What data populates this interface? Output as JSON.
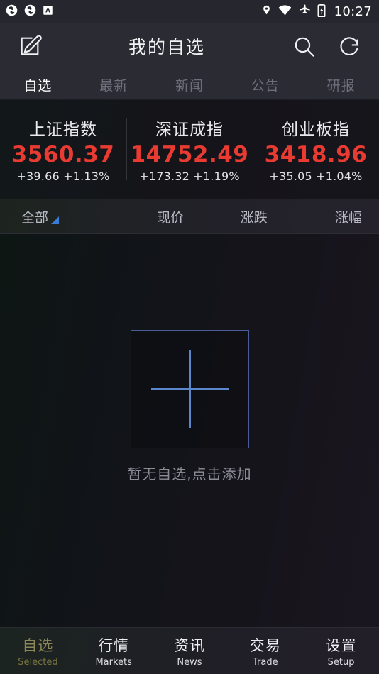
{
  "status_bar": {
    "notification_icons": [
      "sync-circle-icon",
      "sync-circle-icon",
      "letter-a-badge-icon"
    ],
    "system_icons": [
      "location-pin-icon",
      "wifi-icon",
      "airplane-mode-icon",
      "battery-charging-icon"
    ],
    "time": "10:27"
  },
  "header": {
    "edit_icon": "edit-square-icon",
    "title": "我的自选",
    "search_icon": "search-icon",
    "refresh_icon": "refresh-icon"
  },
  "tabs": [
    {
      "label": "自选",
      "active": true
    },
    {
      "label": "最新",
      "active": false
    },
    {
      "label": "新闻",
      "active": false
    },
    {
      "label": "公告",
      "active": false
    },
    {
      "label": "研报",
      "active": false
    }
  ],
  "indices": [
    {
      "name": "上证指数",
      "value": "3560.37",
      "change": "+39.66 +1.13%"
    },
    {
      "name": "深证成指",
      "value": "14752.49",
      "change": "+173.32 +1.19%"
    },
    {
      "name": "创业板指",
      "value": "3418.96",
      "change": "+35.05 +1.04%"
    }
  ],
  "column_header": {
    "filter_label": "全部",
    "sort_indicator": "sort-triangle-icon",
    "columns": [
      "现价",
      "涨跌",
      "涨幅"
    ]
  },
  "empty_state": {
    "add_icon": "plus-icon",
    "message": "暂无自选,点击添加"
  },
  "bottom_nav": [
    {
      "cn": "自选",
      "en": "Selected",
      "active": true
    },
    {
      "cn": "行情",
      "en": "Markets",
      "active": false
    },
    {
      "cn": "资讯",
      "en": "News",
      "active": false
    },
    {
      "cn": "交易",
      "en": "Trade",
      "active": false
    },
    {
      "cn": "设置",
      "en": "Setup",
      "active": false
    }
  ],
  "colors": {
    "up_red": "#ea3b33",
    "accent_blue": "#5a86cc",
    "sort_blue": "#3a7bd5",
    "active_nav": "#8d8757",
    "bar_bg": "#2b2b33"
  }
}
